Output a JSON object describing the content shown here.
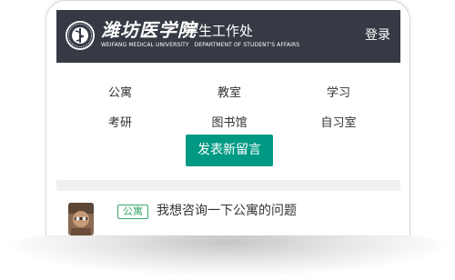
{
  "header": {
    "school_name": "潍坊医学院",
    "dept_name": "学生工作处",
    "school_name_en": "WEIFANG MEDICAL UNIVERSITY",
    "dept_name_en": "DEPARTMENT OF STUDENT'S AFFAIRS",
    "login_label": "登录"
  },
  "nav": {
    "items": [
      {
        "label": "公寓"
      },
      {
        "label": "教室"
      },
      {
        "label": "学习"
      },
      {
        "label": "考研"
      },
      {
        "label": "图书馆"
      },
      {
        "label": "自习室"
      }
    ]
  },
  "actions": {
    "post_label": "发表新留言"
  },
  "messages": [
    {
      "tag": "公寓",
      "title": "我想咨询一下公寓的问题",
      "avatar_icon": "user-avatar-photo"
    }
  ],
  "colors": {
    "header_bg": "#363a44",
    "accent": "#009a84",
    "tag_green": "#3aa86b"
  }
}
